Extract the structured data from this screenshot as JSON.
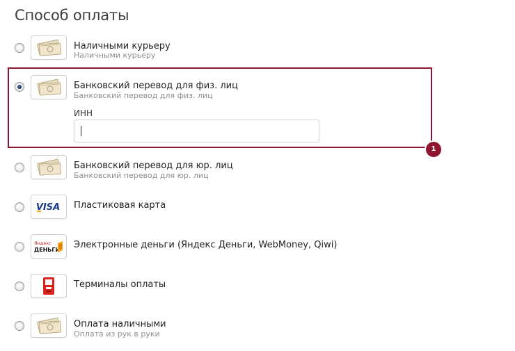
{
  "page_title": "Способ оплаты",
  "payment_methods": [
    {
      "name": "Наличными курьеру",
      "description": "Наличными курьеру",
      "icon": "cash-icon",
      "selected": false
    },
    {
      "name": "Банковский перевод для физ. лиц",
      "description": "Банковский перевод для физ. лиц",
      "icon": "cash-icon",
      "selected": true
    },
    {
      "name": "Банковский перевод для юр. лиц",
      "description": "Банковский перевод для юр. лиц",
      "icon": "cash-icon",
      "selected": false
    },
    {
      "name": "Пластиковая карта",
      "description": "",
      "icon": "visa-icon",
      "selected": false
    },
    {
      "name": "Электронные деньги (Яндекс Деньги, WebMoney, Qiwi)",
      "description": "",
      "icon": "yandex-money-icon",
      "selected": false
    },
    {
      "name": "Терминалы оплаты",
      "description": "",
      "icon": "terminal-icon",
      "selected": false
    },
    {
      "name": "Оплата наличными",
      "description": "Оплата из рук в руки",
      "icon": "cash-icon",
      "selected": false
    }
  ],
  "inn_field": {
    "label": "ИНН",
    "value": ""
  },
  "logos": {
    "visa_text": "VISA",
    "yandex_top": "Яндекс",
    "yandex_bottom": "ДЕНЬГИ"
  },
  "annotation": {
    "number": "1",
    "color": "#8e1530"
  }
}
